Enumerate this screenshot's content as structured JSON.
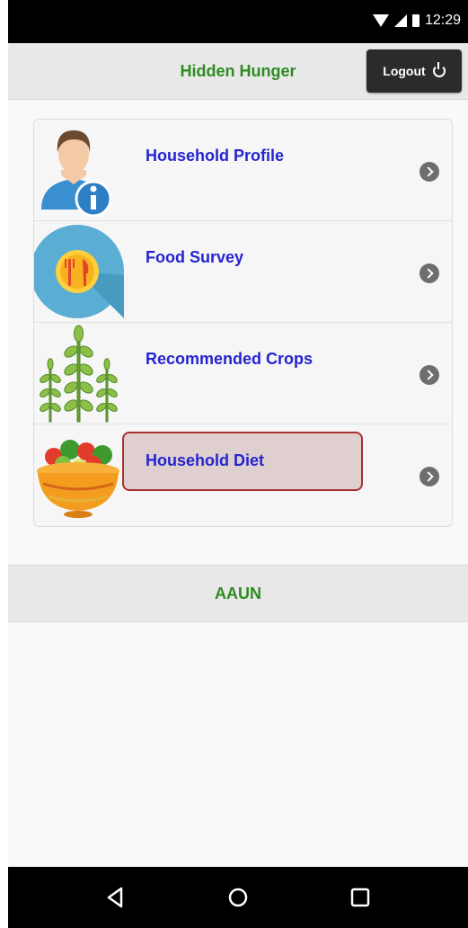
{
  "status_bar": {
    "time": "12:29"
  },
  "header": {
    "title": "Hidden Hunger",
    "logout_label": "Logout"
  },
  "menu": {
    "items": [
      {
        "label": "Household Profile",
        "icon": "user-info-icon"
      },
      {
        "label": "Food Survey",
        "icon": "fork-knife-icon"
      },
      {
        "label": "Recommended Crops",
        "icon": "wheat-icon"
      },
      {
        "label": "Household Diet",
        "icon": "salad-bowl-icon",
        "highlighted": true
      }
    ]
  },
  "footer": {
    "text": "AAUN"
  },
  "colors": {
    "brand_green": "#2e8b22",
    "link_blue": "#2424d0",
    "highlight_border": "#a73131"
  }
}
